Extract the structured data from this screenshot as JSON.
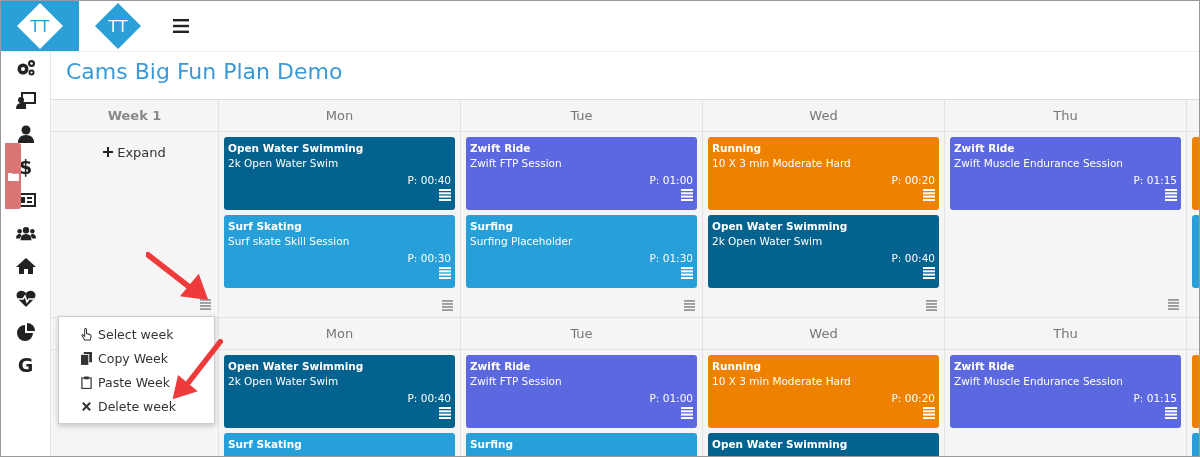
{
  "brand": {
    "logo": "TT",
    "mark": "TT"
  },
  "sidebar": {
    "items": [
      {
        "kind": "gears"
      },
      {
        "kind": "presenter"
      },
      {
        "kind": "user"
      },
      {
        "kind": "glyph",
        "glyph": "$"
      },
      {
        "kind": "card"
      },
      {
        "kind": "group"
      },
      {
        "kind": "home"
      },
      {
        "kind": "heart"
      },
      {
        "kind": "pie"
      },
      {
        "kind": "glyph",
        "glyph": "G"
      }
    ]
  },
  "title": "Cams Big Fun Plan Demo",
  "weeks": [
    {
      "label": "Week 1",
      "expand": "Expand",
      "days": [
        {
          "label": "Mon",
          "sessions": [
            {
              "sport": "Open Water Swimming",
              "name": "2k Open Water Swim",
              "planned": "P: 00:40",
              "color": "#04628f"
            },
            {
              "sport": "Surf Skating",
              "name": "Surf skate Skill Session",
              "planned": "P: 00:30",
              "color": "#27a0da"
            }
          ]
        },
        {
          "label": "Tue",
          "sessions": [
            {
              "sport": "Zwift Ride",
              "name": "Zwift FTP Session",
              "planned": "P: 01:00",
              "color": "#5c68e0"
            },
            {
              "sport": "Surfing",
              "name": "Surfing Placeholder",
              "planned": "P: 01:30",
              "color": "#27a0da"
            }
          ]
        },
        {
          "label": "Wed",
          "sessions": [
            {
              "sport": "Running",
              "name": "10 X 3 min Moderate Hard",
              "planned": "P: 00:20",
              "color": "#ee8200"
            },
            {
              "sport": "Open Water Swimming",
              "name": "2k Open Water Swim",
              "planned": "P: 00:40",
              "color": "#04628f"
            }
          ]
        },
        {
          "label": "Thu",
          "sessions": [
            {
              "sport": "Zwift Ride",
              "name": "Zwift Muscle Endurance Session",
              "planned": "P: 01:15",
              "color": "#5c68e0"
            }
          ]
        }
      ],
      "edge_cards": [
        {
          "color": "#ee8200"
        },
        {
          "color": "#27a0da"
        }
      ]
    },
    {
      "days": [
        {
          "label": "Mon",
          "sessions": [
            {
              "sport": "Open Water Swimming",
              "name": "2k Open Water Swim",
              "planned": "P: 00:40",
              "color": "#04628f"
            },
            {
              "sport": "Surf Skating",
              "color": "#27a0da"
            }
          ]
        },
        {
          "label": "Tue",
          "sessions": [
            {
              "sport": "Zwift Ride",
              "name": "Zwift FTP Session",
              "planned": "P: 01:00",
              "color": "#5c68e0"
            },
            {
              "sport": "Surfing",
              "color": "#27a0da"
            }
          ]
        },
        {
          "label": "Wed",
          "sessions": [
            {
              "sport": "Running",
              "name": "10 X 3 min Moderate Hard",
              "planned": "P: 00:20",
              "color": "#ee8200"
            },
            {
              "sport": "Open Water Swimming",
              "color": "#04628f"
            }
          ]
        },
        {
          "label": "Thu",
          "sessions": [
            {
              "sport": "Zwift Ride",
              "name": "Zwift Muscle Endurance Session",
              "planned": "P: 01:15",
              "color": "#5c68e0"
            }
          ]
        }
      ],
      "edge_cards": [
        {
          "color": "#ee8200"
        },
        {
          "color": "#27a0da"
        }
      ]
    }
  ],
  "week_menu": {
    "items": [
      {
        "kind": "select",
        "label": "Select week"
      },
      {
        "kind": "copy",
        "label": "Copy Week"
      },
      {
        "kind": "paste",
        "label": "Paste Week"
      },
      {
        "kind": "delete",
        "label": "Delete week"
      }
    ]
  }
}
